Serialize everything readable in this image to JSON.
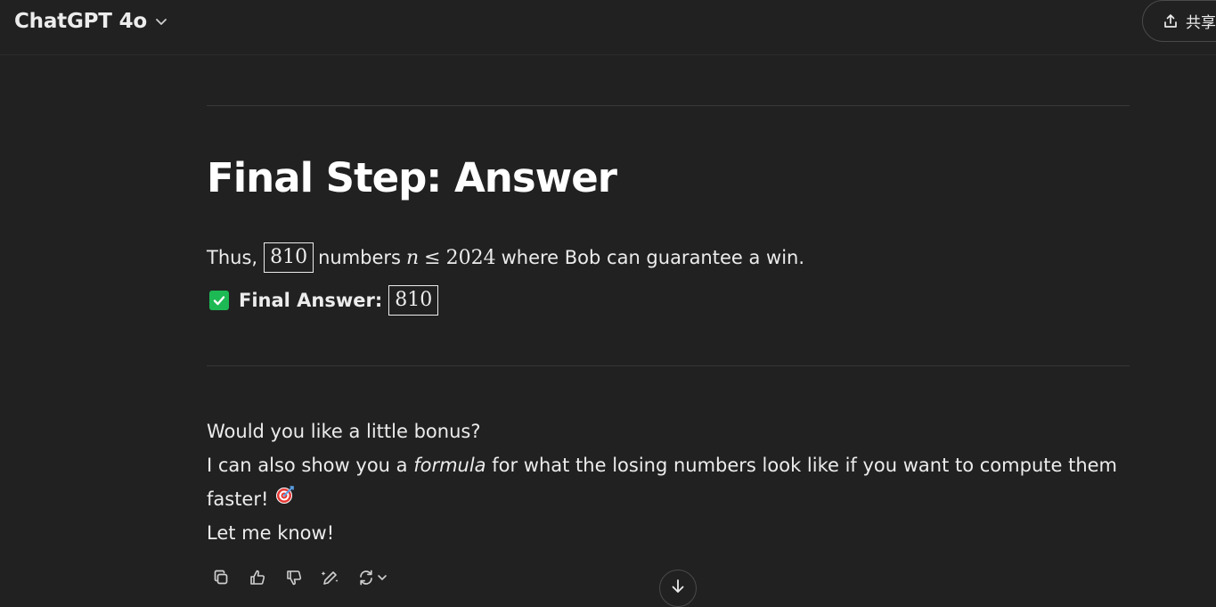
{
  "header": {
    "model_name": "ChatGPT 4o",
    "share_label": "共享"
  },
  "message": {
    "heading": "Final Step: Answer",
    "line1": {
      "prefix": "Thus,",
      "boxed_value": "810",
      "middle": "numbers",
      "math_var": "n",
      "math_op": "≤",
      "math_num": "2024",
      "suffix": "where Bob can guarantee a win."
    },
    "line2": {
      "label": "Final Answer:",
      "boxed_value": "810"
    },
    "bonus": {
      "line1": "Would you like a little bonus?",
      "line2_prefix": "I can also show you a ",
      "line2_italic": "formula",
      "line2_suffix": " for what the losing numbers look like if you want to compute them",
      "line3": "faster!",
      "line4": "Let me know!"
    }
  },
  "actions": [
    "copy-icon",
    "thumbs-up-icon",
    "thumbs-down-icon",
    "edit-icon",
    "regenerate-icon"
  ],
  "colors": {
    "background": "#212121",
    "text": "#ececec",
    "check_green": "#1db954"
  }
}
